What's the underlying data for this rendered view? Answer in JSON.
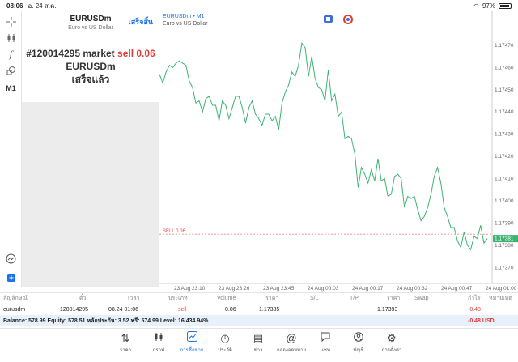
{
  "status": {
    "time": "08:06",
    "date": "อ. 24 ส.ค.",
    "battery": "97%"
  },
  "toolbar": {
    "timeframe": "M1"
  },
  "order_panel": {
    "symbol": "EURUSDm",
    "description": "Euro vs US Dollar",
    "done_label": "เสร็จสิ้น",
    "message_prefix": "#120014295 market",
    "message_side": "sell 0.06",
    "message_symbol": "EURUSDm",
    "message_status": "เสร็จแล้ว"
  },
  "chart": {
    "symbol_label": "EURUSDm • M1",
    "description": "Euro vs US Dollar",
    "sell_label": "SELL 0.06",
    "current_price": "1.17381",
    "line_color": "#3cb371",
    "sell_color": "#e53935"
  },
  "chart_data": {
    "type": "line",
    "ylim": [
      1.17365,
      1.17478
    ],
    "yticks": [
      "1.17470",
      "1.17460",
      "1.17450",
      "1.17440",
      "1.17430",
      "1.17420",
      "1.17410",
      "1.17400",
      "1.17390",
      "1.17380",
      "1.17370"
    ],
    "ytick_values": [
      1.1747,
      1.1746,
      1.1745,
      1.1744,
      1.1743,
      1.1742,
      1.1741,
      1.174,
      1.1739,
      1.1738,
      1.1737
    ],
    "xticks": [
      "23 Aug 23:10",
      "23 Aug 23:26",
      "23 Aug 23:45",
      "24 Aug 00:03",
      "24 Aug 00:17",
      "24 Aug 00:32",
      "24 Aug 00:47",
      "24 Aug 01:00"
    ],
    "sell_level": 1.17385,
    "values": [
      1.17457,
      1.17453,
      1.17458,
      1.17461,
      1.1746,
      1.17462,
      1.17463,
      1.17462,
      1.17461,
      1.17454,
      1.17451,
      1.17444,
      1.17445,
      1.1744,
      1.17446,
      1.17447,
      1.17443,
      1.17443,
      1.17436,
      1.17445,
      1.17443,
      1.17437,
      1.17442,
      1.17447,
      1.17447,
      1.17442,
      1.17435,
      1.17442,
      1.17445,
      1.17439,
      1.17437,
      1.17434,
      1.17439,
      1.17439,
      1.17436,
      1.17438,
      1.17432,
      1.17444,
      1.17449,
      1.17452,
      1.17458,
      1.17456,
      1.17461,
      1.17471,
      1.17469,
      1.17456,
      1.17465,
      1.17455,
      1.17451,
      1.1745,
      1.17445,
      1.17459,
      1.17445,
      1.17448,
      1.17438,
      1.1744,
      1.17428,
      1.17429,
      1.17428,
      1.17421,
      1.17406,
      1.17415,
      1.17412,
      1.17408,
      1.17414,
      1.17409,
      1.17419,
      1.17409,
      1.1741,
      1.17402,
      1.17403,
      1.17411,
      1.17412,
      1.1741,
      1.17397,
      1.17402,
      1.17401,
      1.17402,
      1.17396,
      1.17391,
      1.17393,
      1.17397,
      1.17403,
      1.17411,
      1.17415,
      1.17408,
      1.17397,
      1.17393,
      1.17388,
      1.17388,
      1.17382,
      1.17379,
      1.17386,
      1.1738,
      1.17378,
      1.17384,
      1.17383,
      1.17389,
      1.17381,
      1.17383
    ]
  },
  "positions": {
    "headers": [
      "สัญลักษณ์",
      "ตั๋ว",
      "เวลา",
      "ประเภท",
      "Volume",
      "ราคา",
      "S/L",
      "T/P",
      "ราคา",
      "Swap",
      "กำไร",
      "หมายเหตุ"
    ],
    "row": {
      "symbol": "eurusdm",
      "ticket": "120014295",
      "time": "08.24 01:06",
      "type": "sell",
      "volume": "0.06",
      "price": "1.17385",
      "current": "1.17393",
      "profit": "-0.48"
    },
    "balance_text": "Balance: 578.99 Equity: 578.51 หลักประกัน: 3.52 ฟรี: 574.99 Level: 16 434.94%",
    "total_profit": "-0.48  USD"
  },
  "tabs": [
    {
      "label": "ราคา",
      "icon": "quotes-icon"
    },
    {
      "label": "กราฟ",
      "icon": "chart-icon"
    },
    {
      "label": "การซื้อขาย",
      "icon": "trade-icon"
    },
    {
      "label": "ประวัติ",
      "icon": "history-icon"
    },
    {
      "label": "ข่าว",
      "icon": "news-icon"
    },
    {
      "label": "กล่องจดหมาย",
      "icon": "mailbox-icon"
    },
    {
      "label": "แชท",
      "icon": "chat-icon"
    },
    {
      "label": "บัญชี",
      "icon": "account-icon"
    },
    {
      "label": "การตั้งค่า",
      "icon": "settings-icon"
    }
  ]
}
